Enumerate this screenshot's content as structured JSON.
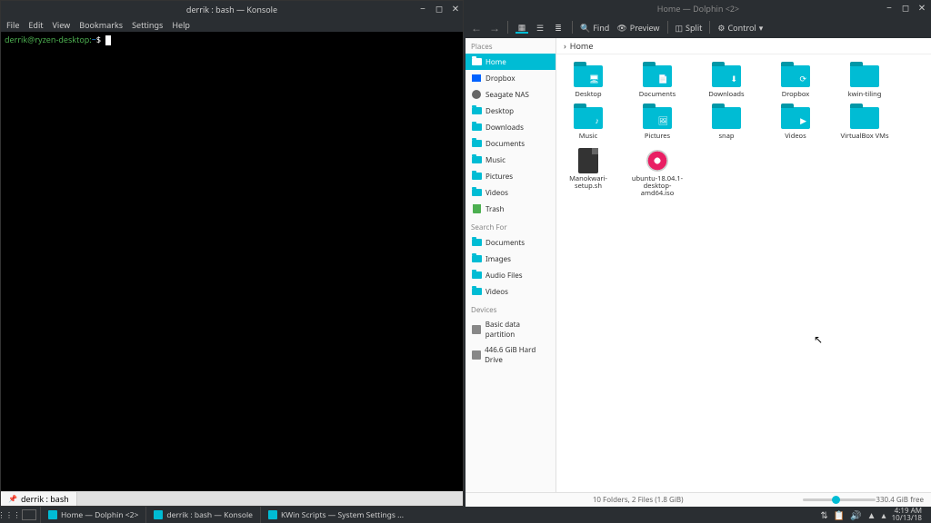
{
  "konsole": {
    "title": "derrik : bash — Konsole",
    "menu": [
      "File",
      "Edit",
      "View",
      "Bookmarks",
      "Settings",
      "Help"
    ],
    "prompt_user": "derrik@ryzen-desktop",
    "prompt_path": "~",
    "prompt_symbol": "$",
    "tab_label": "derrik : bash"
  },
  "dolphin": {
    "title": "Home — Dolphin <2>",
    "toolbar": {
      "find": "Find",
      "preview": "Preview",
      "split": "Split",
      "control": "Control"
    },
    "breadcrumb": "Home",
    "sidebar": {
      "places_heading": "Places",
      "places": [
        {
          "label": "Home",
          "icon": "home",
          "active": true
        },
        {
          "label": "Dropbox",
          "icon": "dropbox"
        },
        {
          "label": "Seagate NAS",
          "icon": "nas"
        },
        {
          "label": "Desktop",
          "icon": "folder"
        },
        {
          "label": "Downloads",
          "icon": "folder"
        },
        {
          "label": "Documents",
          "icon": "folder"
        },
        {
          "label": "Music",
          "icon": "folder"
        },
        {
          "label": "Pictures",
          "icon": "folder"
        },
        {
          "label": "Videos",
          "icon": "folder"
        },
        {
          "label": "Trash",
          "icon": "trash"
        }
      ],
      "search_heading": "Search For",
      "search": [
        {
          "label": "Documents"
        },
        {
          "label": "Images"
        },
        {
          "label": "Audio Files"
        },
        {
          "label": "Videos"
        }
      ],
      "devices_heading": "Devices",
      "devices": [
        {
          "label": "Basic data partition"
        },
        {
          "label": "446.6 GiB Hard Drive"
        }
      ]
    },
    "files": [
      {
        "name": "Desktop",
        "type": "folder",
        "glyph": "🖥"
      },
      {
        "name": "Documents",
        "type": "folder",
        "glyph": "📄"
      },
      {
        "name": "Downloads",
        "type": "folder",
        "glyph": "⬇"
      },
      {
        "name": "Dropbox",
        "type": "folder",
        "glyph": "⟳"
      },
      {
        "name": "kwin-tiling",
        "type": "folder",
        "glyph": ""
      },
      {
        "name": "Music",
        "type": "folder",
        "glyph": "♪"
      },
      {
        "name": "Pictures",
        "type": "folder",
        "glyph": "🖼"
      },
      {
        "name": "snap",
        "type": "folder",
        "glyph": ""
      },
      {
        "name": "Videos",
        "type": "folder",
        "glyph": "▶"
      },
      {
        "name": "VirtualBox VMs",
        "type": "folder",
        "glyph": ""
      },
      {
        "name": "Manokwari-setup.sh",
        "type": "script"
      },
      {
        "name": "ubuntu-18.04.1-desktop-amd64.iso",
        "type": "iso"
      }
    ],
    "status": {
      "summary": "10 Folders, 2 Files (1.8 GiB)",
      "free": "330.4 GiB free"
    }
  },
  "taskbar": {
    "items": [
      "Home — Dolphin <2>",
      "derrik : bash — Konsole",
      "KWin Scripts — System Settings ..."
    ],
    "clock_time": "4:19 AM",
    "clock_date": "10/13/18"
  }
}
